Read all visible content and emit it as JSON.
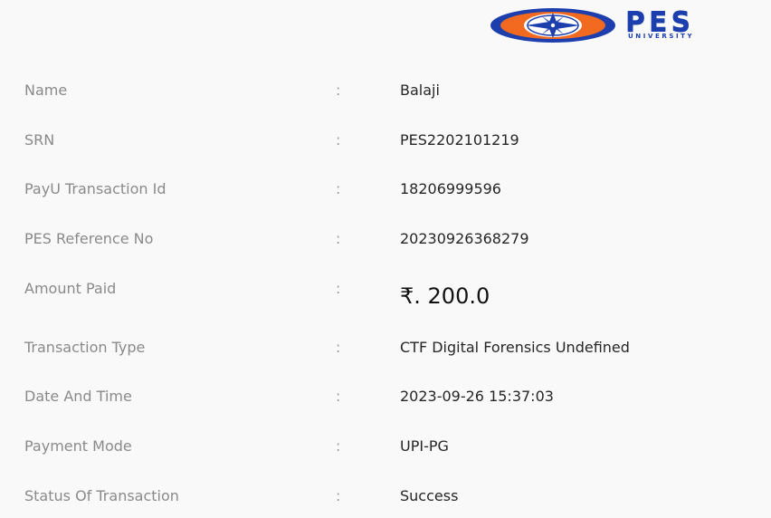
{
  "logo": {
    "wordmark": "PES",
    "subtitle": "UNIVERSITY",
    "colors": {
      "brand_blue": "#1d3fae",
      "brand_orange": "#f26a1f"
    },
    "icon": "compass-star-emblem-icon"
  },
  "receipt": {
    "separator": ":",
    "rows": [
      {
        "label": "Name",
        "value": "Balaji"
      },
      {
        "label": "SRN",
        "value": "PES2202101219"
      },
      {
        "label": "PayU Transaction Id",
        "value": "18206999596"
      },
      {
        "label": "PES Reference No",
        "value": "20230926368279"
      },
      {
        "label": "Amount Paid",
        "value": "₹. 200.0"
      },
      {
        "label": "Transaction Type",
        "value": "CTF Digital Forensics Undefined"
      },
      {
        "label": "Date And Time",
        "value": "2023-09-26 15:37:03"
      },
      {
        "label": "Payment Mode",
        "value": "UPI-PG"
      },
      {
        "label": "Status Of Transaction",
        "value": "Success"
      }
    ]
  }
}
